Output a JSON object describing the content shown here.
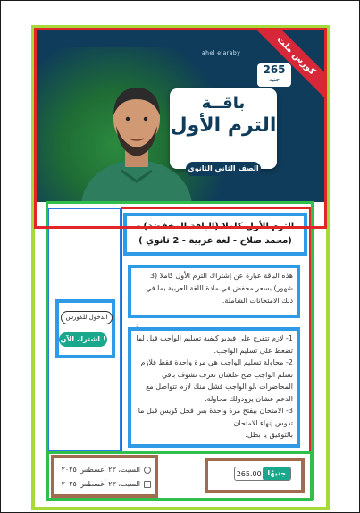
{
  "banner": {
    "logo_text": "ahel elaraby",
    "ribbon": "كورس ملت",
    "price_number": "265",
    "price_unit": "جنيه",
    "title_line1": "باقــة",
    "title_line2": "الترم الأول",
    "title_line3": "الصف الثاني الثانوي"
  },
  "course": {
    "title": "الترم الأول كاملا (الباقة المخفضة) - (محمد صلاح - لغة عربية - 2 ثانوي )",
    "description": "هذه الباقة عبارة عن إشتراك الترم الأول كاملا (3 شهور) بسعر مخفض في مادة اللغة العربية بما في ذلك الامتحانات الشاملة.",
    "notes_separator": ":",
    "notes": [
      "1- لازم تتفرج على فيديو كيفية تسليم الواجب قبل لما تضغط على تسليم الواجب.",
      "2- محاولة تسليم الواجب هي مرة واحدة فقط فلازم تسلم الواجب صح علشان تعرف تشوف باقي المحاضرات ،لو الواجب فشل منك لازم تتواصل مع الدعم عشان يزودولك محاولة.",
      "3- الامتحان بيفتح مرة واحدة بس فحل كويس قبل ما تدوس إنهاء الامتحان ..",
      "بالتوفيق يا بطل."
    ]
  },
  "actions": {
    "enter_course": "الدخول للكورس",
    "subscribe": "اشترك الآن !"
  },
  "dates": {
    "start": "السبت، ٢٣ أغسطس ٢٠٢٥",
    "end": "السبت، ٢٣ أغسطس ٢٠٢٥"
  },
  "price": {
    "amount": "265.00",
    "currency": "جنيهًا"
  },
  "colors": {
    "banner_bg": "#0f3c5a",
    "accent": "#1aa88c",
    "ribbon": "#d62839"
  }
}
